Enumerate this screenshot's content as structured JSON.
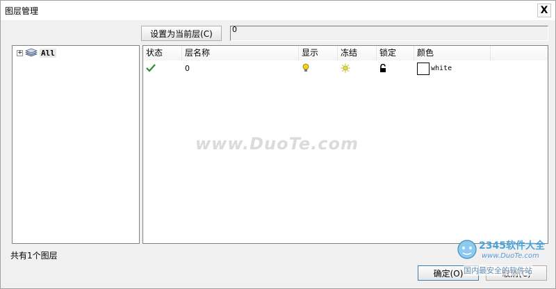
{
  "window": {
    "title": "图层管理",
    "close_label": "X"
  },
  "toolbar": {
    "set_current_label": "设置为当前层(C)",
    "current_layer_value": "0"
  },
  "tree": {
    "expander": "+",
    "root_label": "All"
  },
  "table": {
    "columns": [
      "状态",
      "层名称",
      "显示",
      "冻结",
      "锁定",
      "颜色"
    ],
    "rows": [
      {
        "name": "0",
        "color_name": "white",
        "color_hex": "#ffffff"
      }
    ]
  },
  "status": {
    "count_text": "共有1个图层"
  },
  "buttons": {
    "ok_label": "确定(O)",
    "cancel_label": "取消(C)"
  },
  "watermark": {
    "text": "www.DuoTe.com",
    "badge_brand": "2345软件大全",
    "badge_url": "www.DuoTe.com",
    "badge_slogan": "国内最安全的软件站"
  },
  "colors": {
    "check_green": "#2e8b2e",
    "bulb_yellow": "#f2d21b",
    "sun_yellow": "#e8e03a"
  }
}
